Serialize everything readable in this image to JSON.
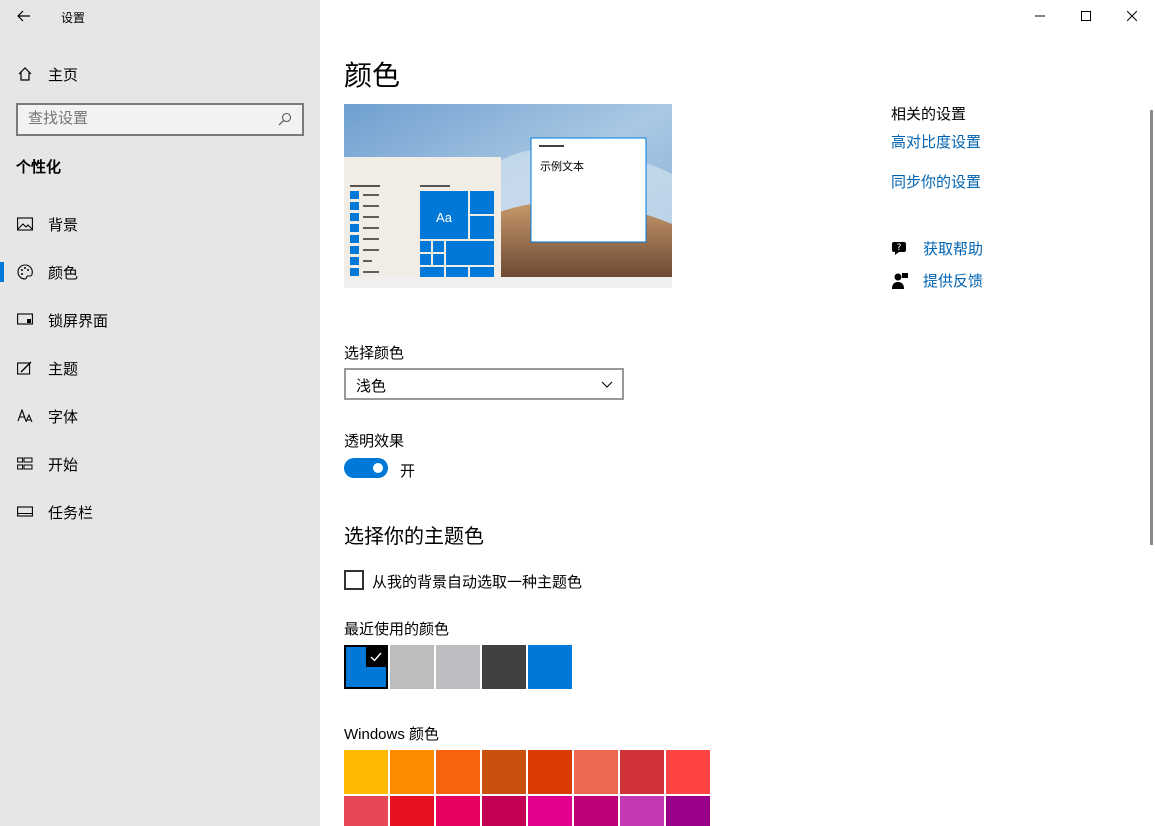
{
  "window": {
    "title": "设置"
  },
  "sidebar": {
    "home_label": "主页",
    "search_placeholder": "查找设置",
    "section": "个性化",
    "items": [
      {
        "label": "背景",
        "icon": "picture-icon"
      },
      {
        "label": "颜色",
        "icon": "palette-icon",
        "active": true
      },
      {
        "label": "锁屏界面",
        "icon": "lock-screen-icon"
      },
      {
        "label": "主题",
        "icon": "theme-icon"
      },
      {
        "label": "字体",
        "icon": "font-icon"
      },
      {
        "label": "开始",
        "icon": "start-icon"
      },
      {
        "label": "任务栏",
        "icon": "taskbar-icon"
      }
    ]
  },
  "main": {
    "title": "颜色",
    "preview": {
      "tile_text": "Aa",
      "sample_text": "示例文本"
    },
    "choose_color": {
      "label": "选择颜色",
      "value": "浅色"
    },
    "transparency": {
      "label": "透明效果",
      "state": "开",
      "on": true
    },
    "accent_title": "选择你的主题色",
    "auto_pick_label": "从我的背景自动选取一种主题色",
    "recent": {
      "label": "最近使用的颜色",
      "colors": [
        "#0078d7",
        "#bdbdbd",
        "#bdbec1",
        "#404040",
        "#0078d7"
      ],
      "selected": 0
    },
    "windows_colors": {
      "label": "Windows 颜色",
      "colors": [
        "#ffb900",
        "#ff8c00",
        "#f7630c",
        "#ca5010",
        "#da3b01",
        "#ef6950",
        "#d13438",
        "#ff4343",
        "#e74856",
        "#e81123",
        "#ea005e",
        "#c30052",
        "#e3008c",
        "#bf0077",
        "#c239b3",
        "#9a0089"
      ]
    }
  },
  "related": {
    "heading": "相关的设置",
    "links": [
      "高对比度设置",
      "同步你的设置"
    ],
    "help": "获取帮助",
    "feedback": "提供反馈"
  },
  "accent": "#0078d7"
}
